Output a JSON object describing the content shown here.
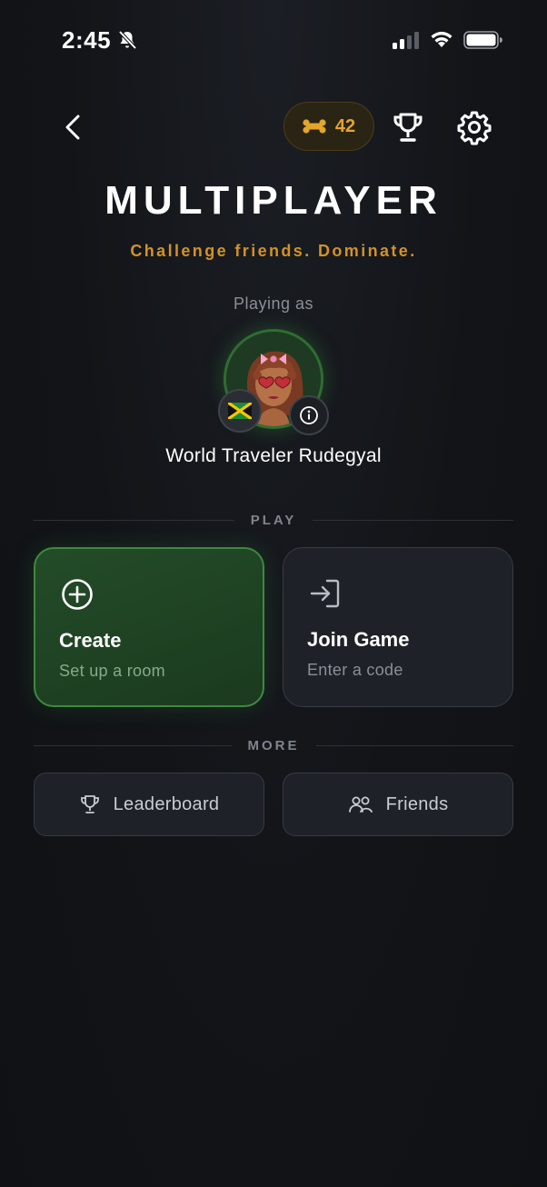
{
  "status_bar": {
    "time": "2:45",
    "icons": [
      "bell-off-icon",
      "signal-icon",
      "wifi-icon",
      "battery-icon"
    ]
  },
  "nav": {
    "back_icon": "chevron-left-icon",
    "bones": {
      "icon": "bone-icon",
      "count": "42"
    },
    "trophy_icon": "trophy-icon",
    "settings_icon": "gear-icon"
  },
  "header": {
    "title": "MULTIPLAYER",
    "subtitle": "Challenge friends. Dominate."
  },
  "player": {
    "playing_as_label": "Playing as",
    "name": "World Traveler Rudegyal",
    "flag_icon": "jamaica-flag-icon",
    "info_icon": "info-icon"
  },
  "sections": {
    "play_label": "PLAY",
    "more_label": "MORE"
  },
  "play_cards": [
    {
      "title": "Create",
      "subtitle": "Set up a room",
      "icon": "plus-circle-icon"
    },
    {
      "title": "Join Game",
      "subtitle": "Enter a code",
      "icon": "sign-in-icon"
    }
  ],
  "more_buttons": [
    {
      "label": "Leaderboard",
      "icon": "trophy-icon"
    },
    {
      "label": "Friends",
      "icon": "users-icon"
    }
  ],
  "colors": {
    "background": "#12151a",
    "accent_gold": "#e3a52a",
    "accent_green": "#3d8a3f",
    "card_dark": "#1e2127"
  }
}
